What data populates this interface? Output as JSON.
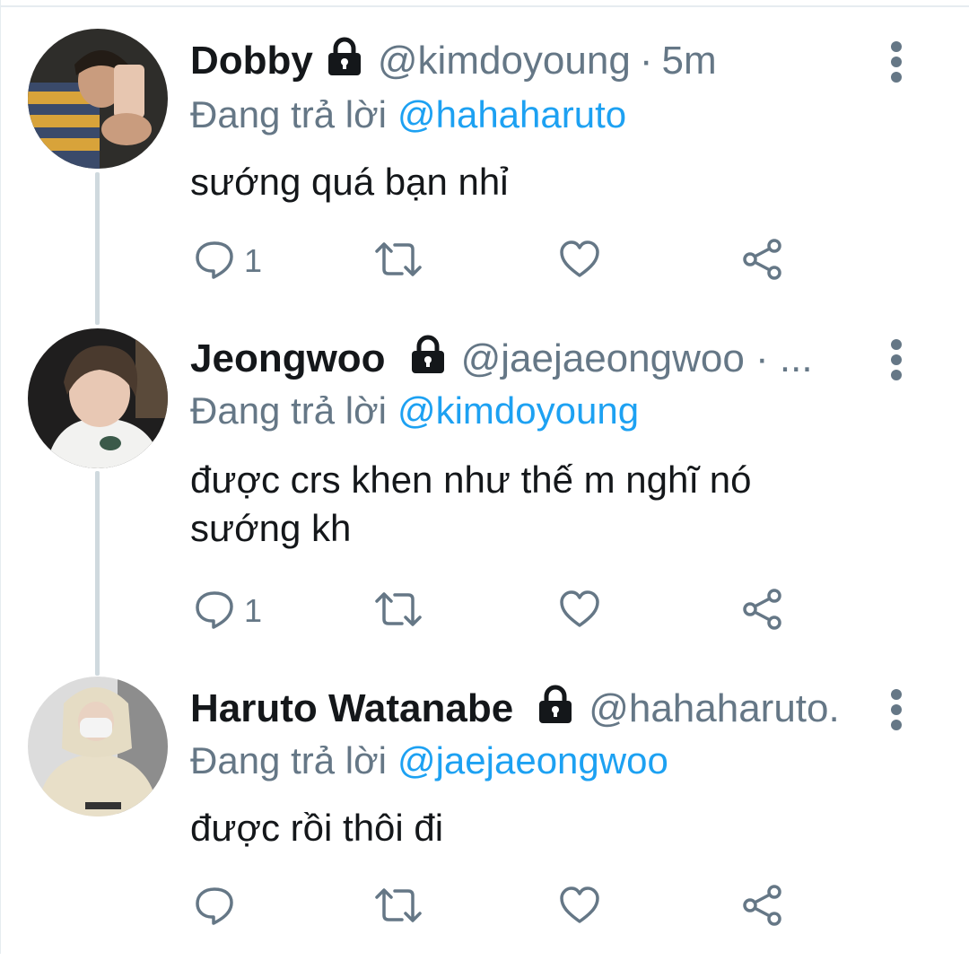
{
  "tweets": [
    {
      "name": "Dobby",
      "handle": "@kimdoyoung",
      "separator": "·",
      "time": "5m",
      "reply_prefix": "Đang trả lời",
      "reply_to": "@hahaharuto",
      "text": "sướng quá bạn nhỉ",
      "reply_count": "1",
      "avatar_color": "#3b3a36"
    },
    {
      "name": "Jeongwoo",
      "handle": "@jaejaeongwoo · ...",
      "separator": "",
      "time": "",
      "reply_prefix": "Đang trả lời",
      "reply_to": "@kimdoyoung",
      "text_line1": "được crs khen như thế m nghĩ nó",
      "text_line2": "sướng kh",
      "reply_count": "1",
      "avatar_color": "#2b2a2a"
    },
    {
      "name": "Haruto Watanabe",
      "handle": "@hahaharuto.",
      "separator": "",
      "time": "",
      "reply_prefix": "Đang trả lời",
      "reply_to": "@jaejaeongwoo",
      "text": "được rồi thôi đi",
      "reply_count": "",
      "avatar_color": "#c9c3b5"
    }
  ],
  "icons": {
    "lock": "lock-icon",
    "more": "more-vertical-icon",
    "reply": "comment-icon",
    "retweet": "retweet-icon",
    "like": "heart-icon",
    "share": "share-icon"
  },
  "colors": {
    "text": "#14171a",
    "muted": "#657786",
    "link": "#1da1f2",
    "thread_line": "#cfd9de"
  }
}
